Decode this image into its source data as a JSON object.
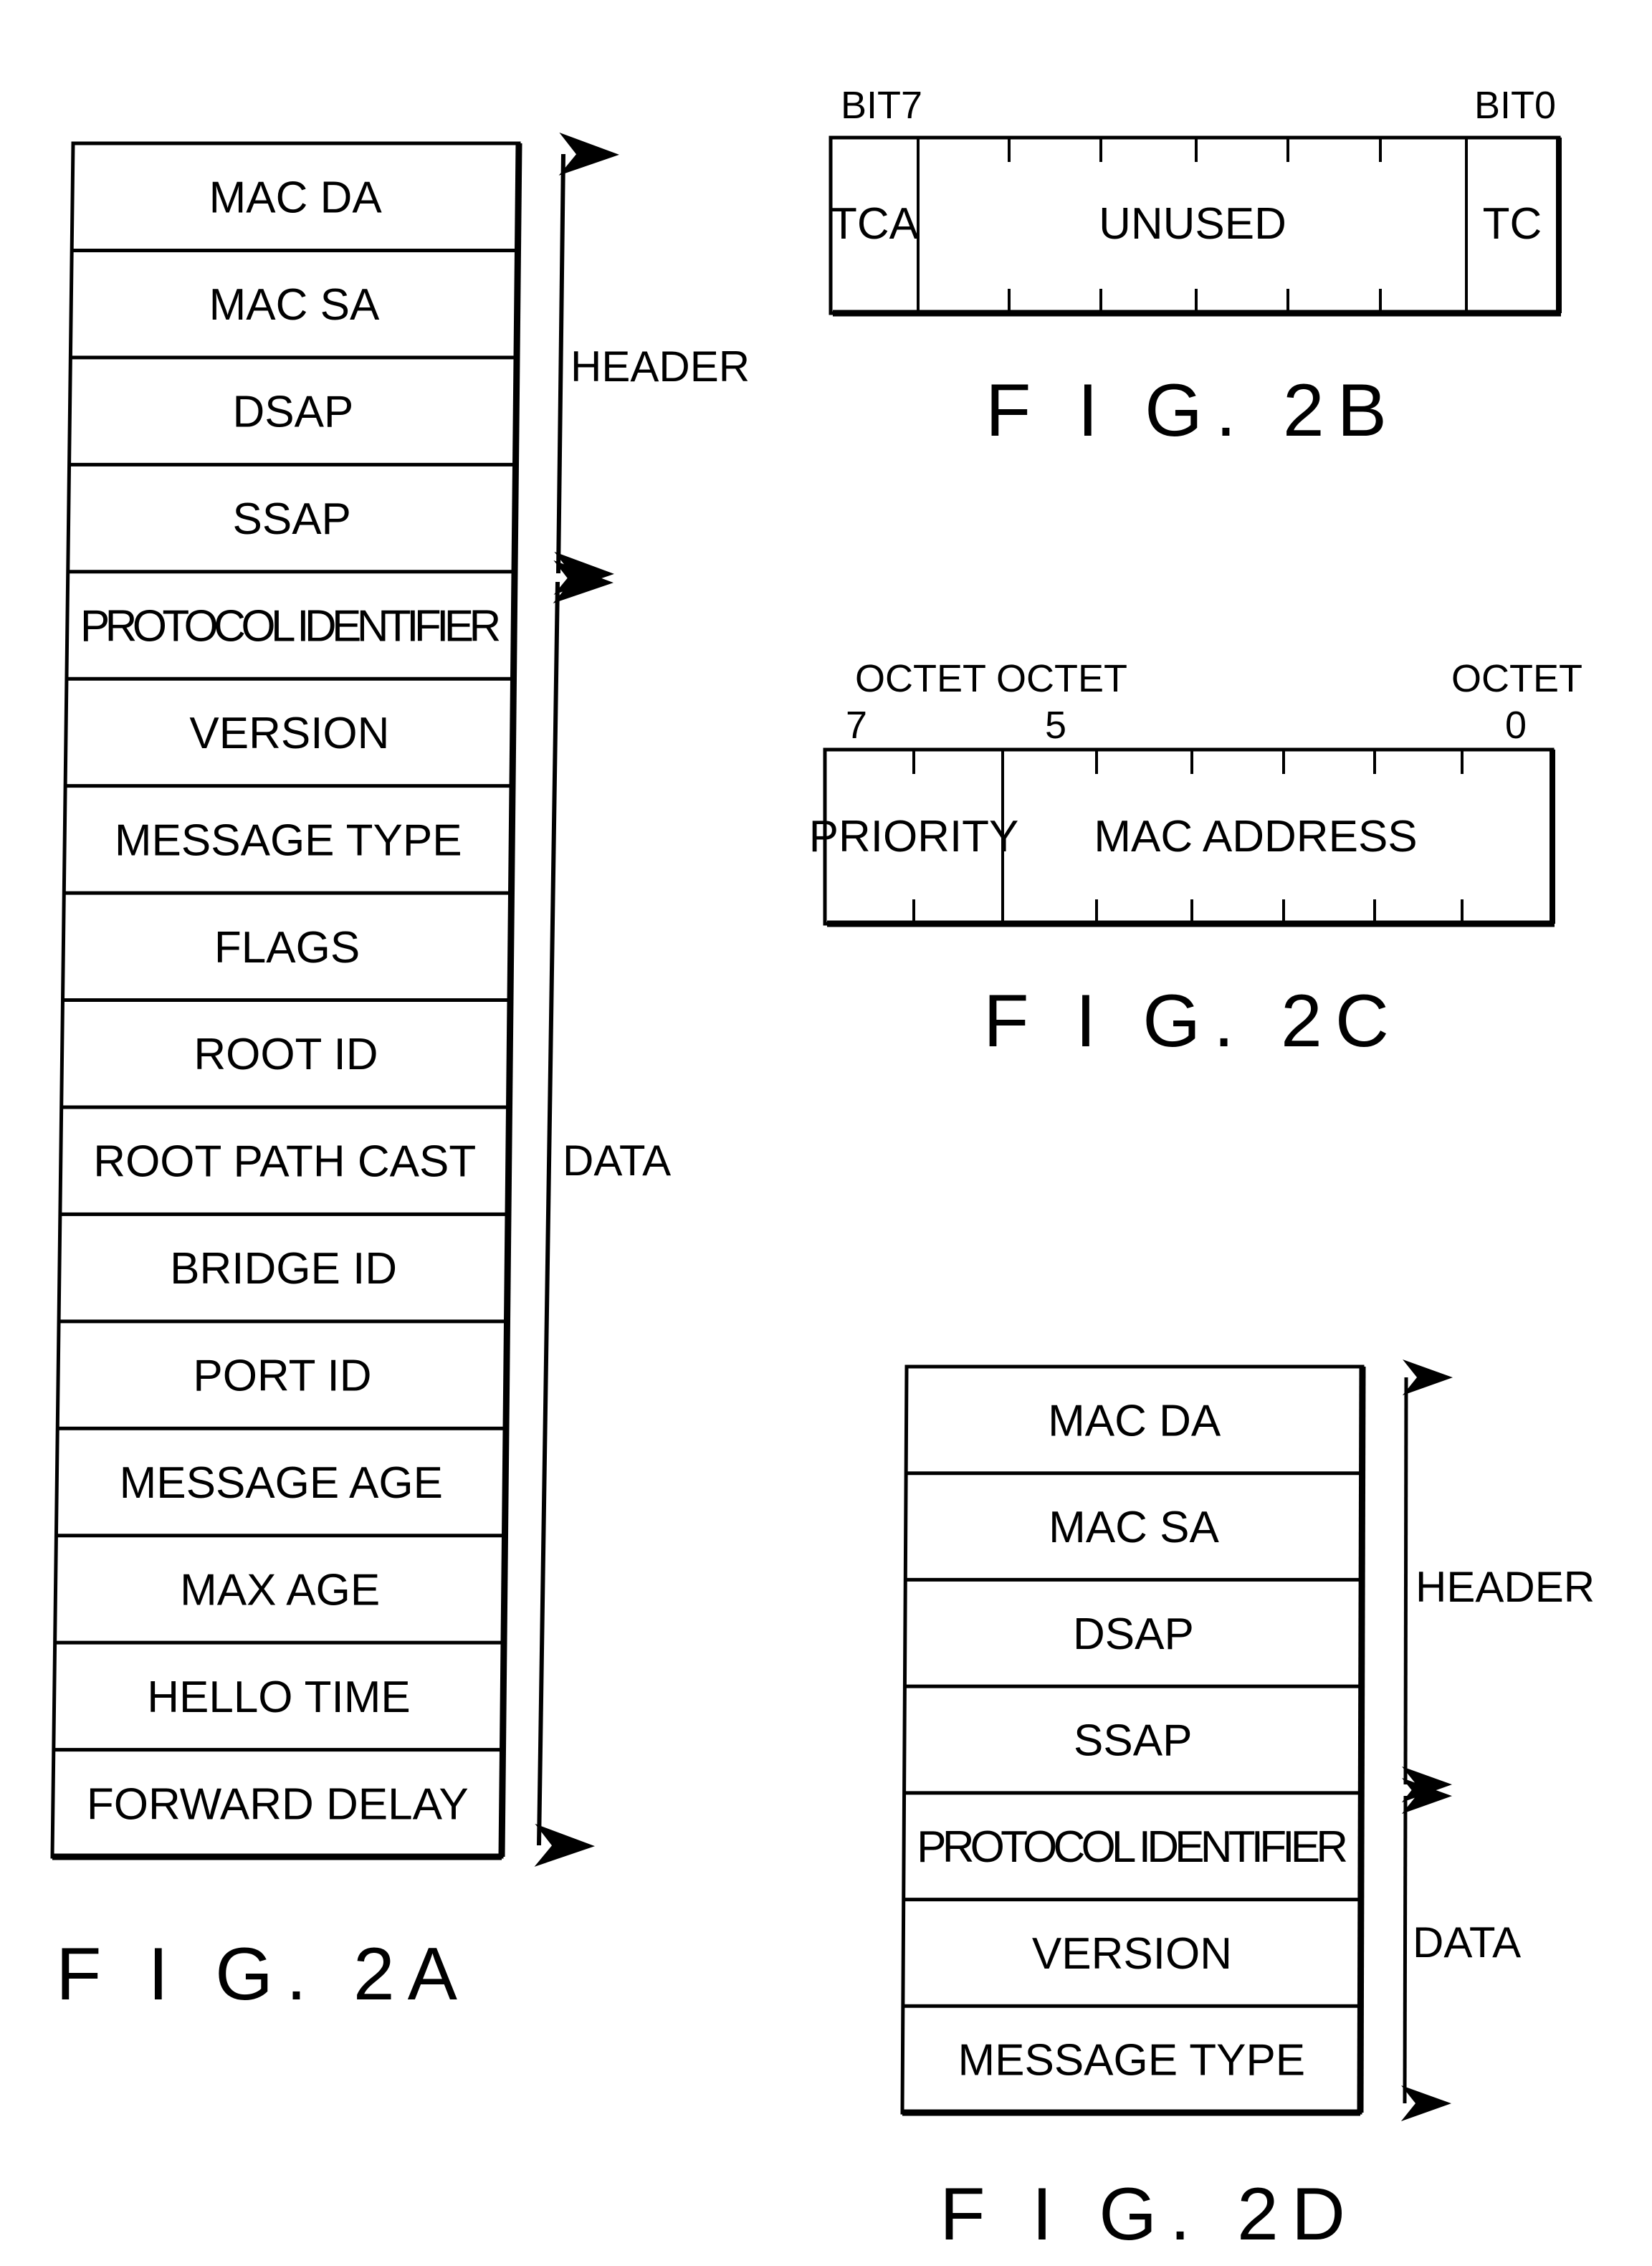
{
  "figures": {
    "fig2a": {
      "caption": "F I G. 2A",
      "fields": [
        "MAC DA",
        "MAC SA",
        "DSAP",
        "SSAP",
        "PROTOCOL IDENTIFIER",
        "VERSION",
        "MESSAGE TYPE",
        "FLAGS",
        "ROOT ID",
        "ROOT PATH CAST",
        "BRIDGE ID",
        "PORT ID",
        "MESSAGE AGE",
        "MAX AGE",
        "HELLO TIME",
        "FORWARD DELAY"
      ],
      "header_label": "HEADER",
      "data_label": "DATA",
      "header_field_count": 4
    },
    "fig2b": {
      "caption": "F I G. 2B",
      "left_bit_label": "BIT7",
      "right_bit_label": "BIT0",
      "fields": [
        "TCA",
        "UNUSED",
        "TC"
      ]
    },
    "fig2c": {
      "caption": "F I G. 2C",
      "octet_label_left": "OCTET OCTET",
      "octet_label_right": "OCTET",
      "octet_7": "7",
      "octet_5": "5",
      "octet_0": "0",
      "fields": [
        "PRIORITY",
        "MAC ADDRESS"
      ]
    },
    "fig2d": {
      "caption": "F I G. 2D",
      "fields": [
        "MAC DA",
        "MAC SA",
        "DSAP",
        "SSAP",
        "PROTOCOL IDENTIFIER",
        "VERSION",
        "MESSAGE TYPE"
      ],
      "header_label": "HEADER",
      "data_label": "DATA",
      "header_field_count": 4
    }
  }
}
